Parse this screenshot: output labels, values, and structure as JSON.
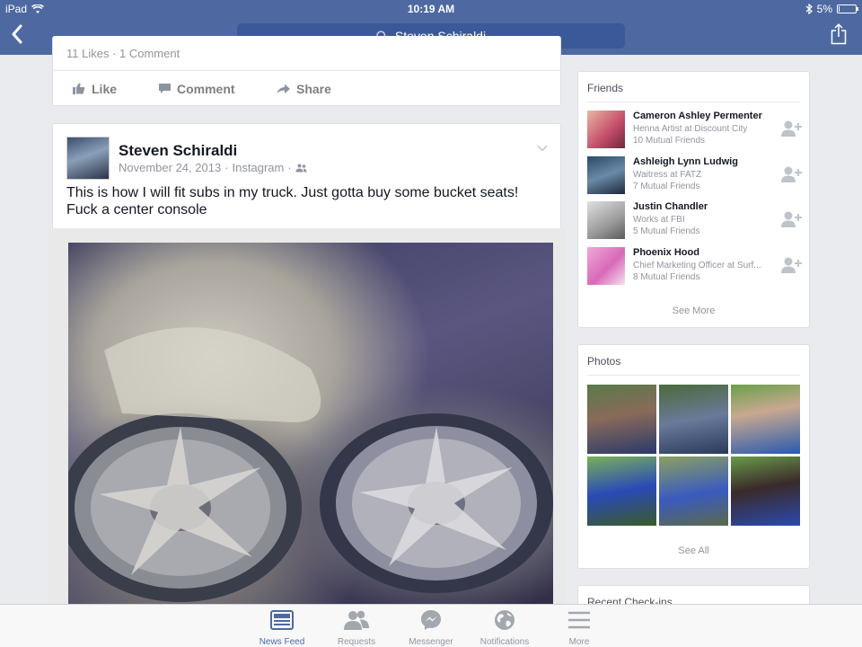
{
  "status_bar": {
    "device": "iPad",
    "time": "10:19 AM",
    "battery": "5%",
    "battery_level": 0.05,
    "wifi_icon": "wifi-icon",
    "bluetooth_icon": "bluetooth-icon"
  },
  "nav": {
    "search_text": "Steven Schiraldi",
    "back_icon": "chevron-left-icon",
    "share_icon": "share-icon"
  },
  "previous_post": {
    "stats": "11 Likes · 1 Comment",
    "like_label": "Like",
    "comment_label": "Comment",
    "share_label": "Share"
  },
  "post": {
    "author": "Steven Schiraldi",
    "date": "November 24, 2013",
    "via": "Instagram",
    "separator": "·",
    "privacy_icon": "friends-icon",
    "text": "This is how I will fit subs in my truck. Just gotta buy some bucket seats! Fuck a center console"
  },
  "friends": {
    "title": "Friends",
    "see_more": "See More",
    "items": [
      {
        "name": "Cameron Ashley Permenter",
        "work": "Henna Artist at Discount City",
        "mutual": "10 Mutual Friends"
      },
      {
        "name": "Ashleigh Lynn Ludwig",
        "work": "Waitress at FATZ",
        "mutual": "7 Mutual Friends"
      },
      {
        "name": "Justin Chandler",
        "work": "Works at FBI",
        "mutual": "5 Mutual Friends"
      },
      {
        "name": "Phoenix Hood",
        "work": "Chief Marketing Officer at Surf...",
        "mutual": "8 Mutual Friends"
      }
    ]
  },
  "photos": {
    "title": "Photos",
    "see_all": "See All"
  },
  "checkins": {
    "title": "Recent Check-ins"
  },
  "tabbar": {
    "items": [
      {
        "label": "News Feed",
        "icon": "news-feed-icon",
        "active": true
      },
      {
        "label": "Requests",
        "icon": "requests-icon",
        "active": false
      },
      {
        "label": "Messenger",
        "icon": "messenger-icon",
        "active": false
      },
      {
        "label": "Notifications",
        "icon": "globe-icon",
        "active": false
      },
      {
        "label": "More",
        "icon": "menu-icon",
        "active": false
      }
    ]
  },
  "colors": {
    "brand": "#4e69a2",
    "search_bg": "#3b5998",
    "background": "#e9ebee",
    "muted_text": "#90949c"
  }
}
